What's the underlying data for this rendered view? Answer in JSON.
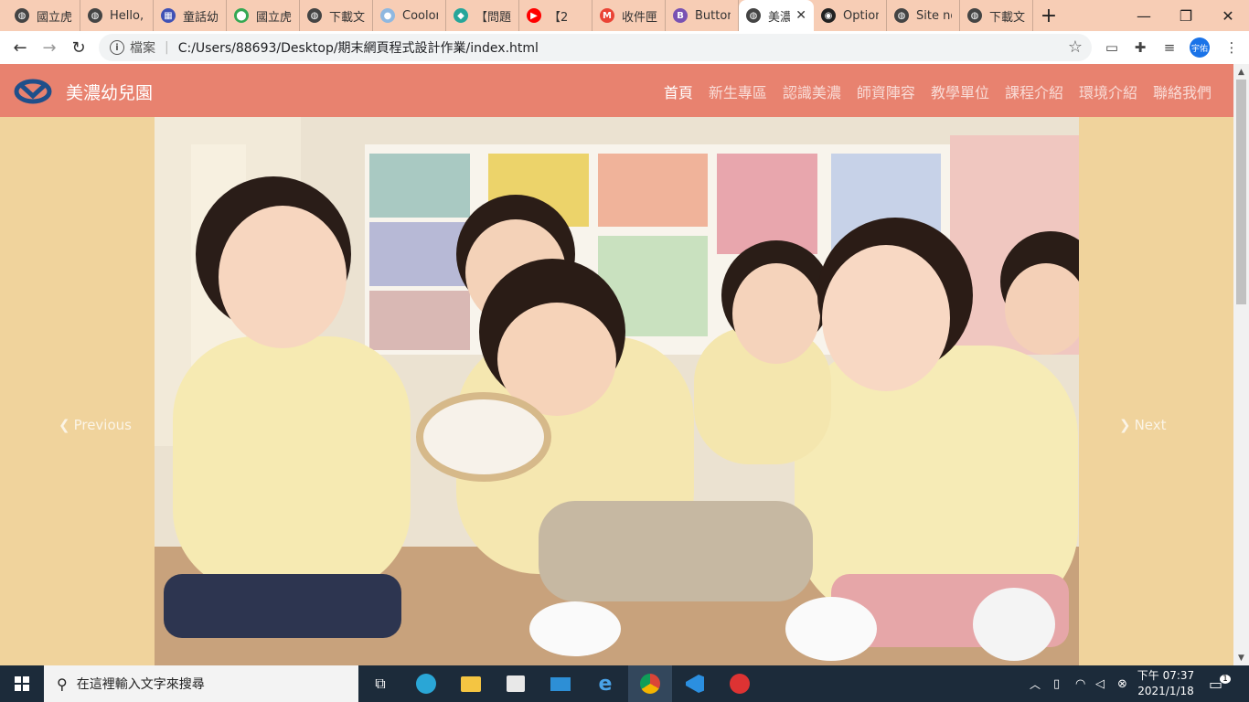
{
  "browser": {
    "tabs": [
      {
        "title": "國立虎",
        "favicon": "globe-icon"
      },
      {
        "title": "Hello, v",
        "favicon": "globe-icon"
      },
      {
        "title": "童話幼",
        "favicon": "grid-icon"
      },
      {
        "title": "國立虎",
        "favicon": "map-pin-icon"
      },
      {
        "title": "下載文",
        "favicon": "globe-icon"
      },
      {
        "title": "Coolor",
        "favicon": "coolors-icon"
      },
      {
        "title": "【問題】",
        "favicon": "chat-icon"
      },
      {
        "title": "【2",
        "favicon": "youtube-icon"
      },
      {
        "title": "收件匣",
        "favicon": "gmail-icon"
      },
      {
        "title": "Button",
        "favicon": "bootstrap-icon"
      },
      {
        "title": "美濃",
        "favicon": "globe-icon",
        "active": true
      },
      {
        "title": "Option",
        "favicon": "github-icon"
      },
      {
        "title": "Site no",
        "favicon": "globe-icon"
      },
      {
        "title": "下載文",
        "favicon": "globe-icon"
      }
    ],
    "new_tab_label": "+",
    "minimize": "—",
    "restore": "❐",
    "close": "✕",
    "address": {
      "security_label": "檔案",
      "separator": "|",
      "url": "C:/Users/88693/Desktop/期末網頁程式設計作業/index.html"
    },
    "profile_initials": "宇佑"
  },
  "page": {
    "brand": "美濃幼兒園",
    "nav": [
      {
        "label": "首頁",
        "active": true
      },
      {
        "label": "新生專區"
      },
      {
        "label": "認識美濃"
      },
      {
        "label": "師資陣容"
      },
      {
        "label": "教學單位"
      },
      {
        "label": "課程介紹"
      },
      {
        "label": "環境介紹"
      },
      {
        "label": "聯絡我們"
      }
    ],
    "carousel": {
      "prev_label": "Previous",
      "next_label": "Next",
      "image_alt": "kindergarten children playing tambourines"
    }
  },
  "taskbar": {
    "search_placeholder": "在這裡輸入文字來搜尋",
    "time": "下午 07:37",
    "date": "2021/1/18",
    "notification_count": "1"
  },
  "colors": {
    "navbar": "#e8826f",
    "page_bg": "#f0d39c",
    "tabstrip": "#f7cdb5"
  }
}
